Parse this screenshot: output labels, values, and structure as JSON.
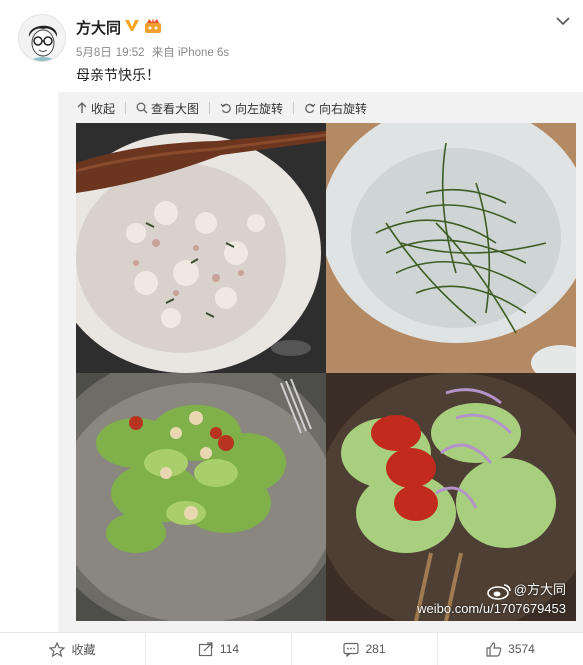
{
  "post": {
    "author": "方大同",
    "date": "5月8日",
    "time": "19:52",
    "source": "来自 iPhone 6s",
    "text": "母亲节快乐！"
  },
  "toolbar": {
    "collapse_label": "收起",
    "view_large_label": "查看大图",
    "rotate_left_label": "向左旋转",
    "rotate_right_label": "向右旋转"
  },
  "watermark": {
    "handle": "@方大同",
    "url": "weibo.com/u/1707679453"
  },
  "footer": {
    "favorite_label": "收藏",
    "repost_count": "114",
    "comment_count": "281",
    "like_count": "3574"
  },
  "colors": {
    "verified": "#f5a623",
    "accent": "#eb7350",
    "background": "#f2f2f2"
  },
  "icons": [
    "avatar",
    "verified-icon",
    "vip-badge-icon",
    "chevron-down-icon",
    "collapse-icon",
    "zoom-icon",
    "rotate-left-icon",
    "rotate-right-icon",
    "weibo-logo-icon",
    "star-icon",
    "repost-icon",
    "comment-icon",
    "like-icon"
  ]
}
